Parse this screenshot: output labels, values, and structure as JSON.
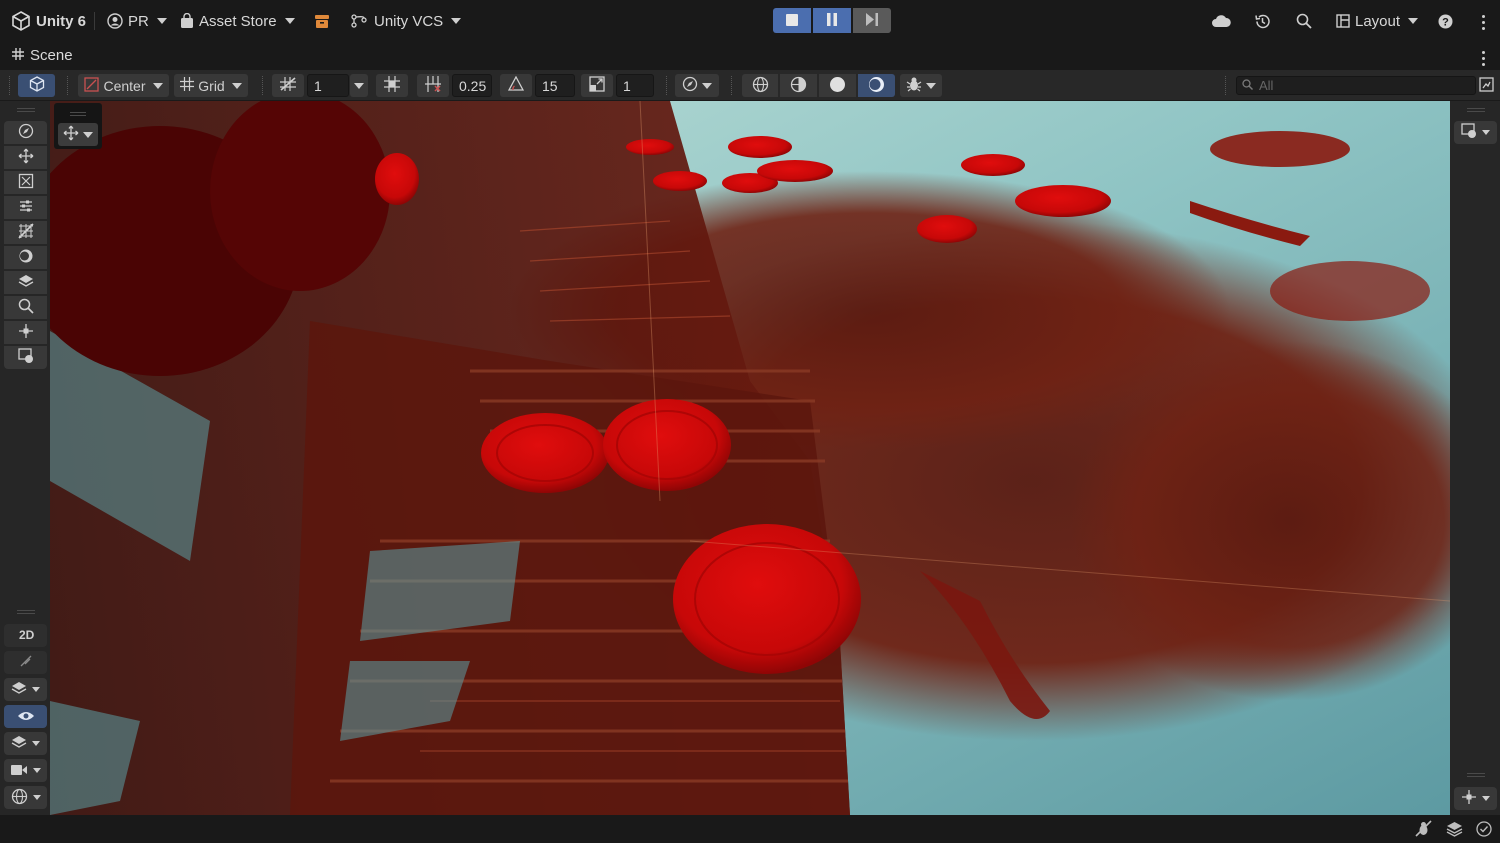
{
  "topbar": {
    "product": "Unity 6",
    "account": "PR",
    "asset_store": "Asset Store",
    "vcs": "Unity VCS",
    "layout": "Layout"
  },
  "scene_tab": {
    "title": "Scene"
  },
  "scene_toolbar": {
    "pivot": "Center",
    "handle_space": "Grid",
    "grid_size": "1",
    "snap_move": "0.25",
    "snap_rotate": "15",
    "snap_scale": "1",
    "search_placeholder": "All"
  },
  "colors": {
    "accent": "#4b6eaf",
    "selected_tool": "#3a4f73",
    "panel": "#282828",
    "background": "#191919"
  },
  "icons": [
    "unity-logo-icon",
    "account-icon",
    "shopping-bag-icon",
    "package-box-icon",
    "vcs-branch-icon",
    "stop-icon",
    "pause-icon",
    "step-icon",
    "cloud-icon",
    "history-icon",
    "search-icon",
    "layout-icon",
    "help-icon",
    "hash-icon",
    "kebab-icon",
    "cube-icon",
    "orientation-gizmo-icon",
    "view-tool-icon",
    "move-tool-icon",
    "rotate-tool-icon",
    "scale-tool-icon",
    "rect-tool-icon",
    "transform-tool-icon",
    "custom-tool-icon",
    "layers-tool-icon",
    "zoom-tool-icon",
    "scene-camera-icon",
    "eye-icon",
    "camera-icon",
    "globe-icon"
  ]
}
